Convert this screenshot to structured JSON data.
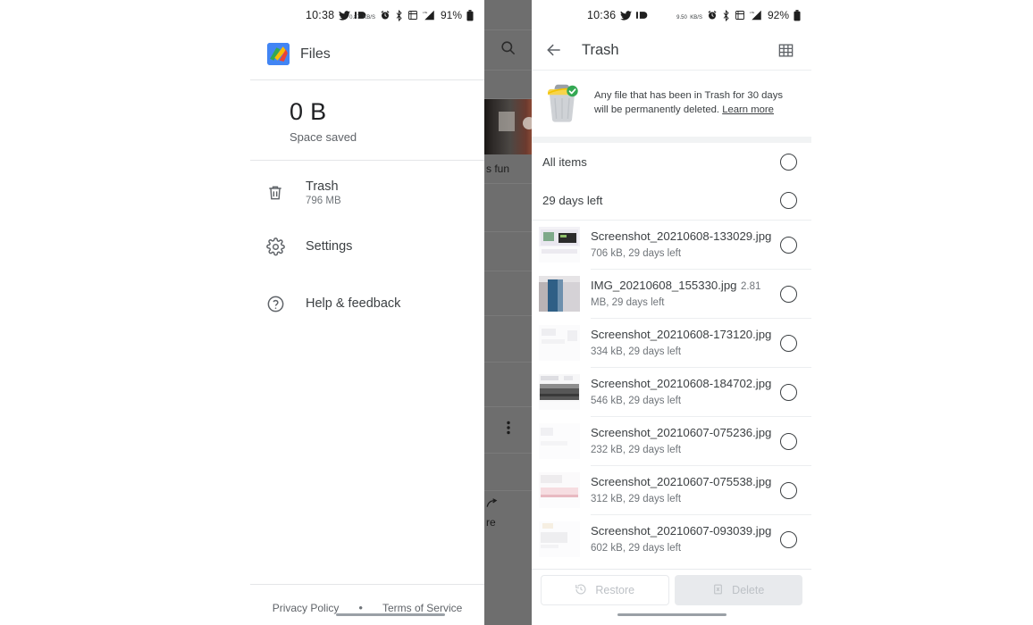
{
  "left_phone": {
    "status_bar": {
      "time": "10:38",
      "battery_percent": "91%",
      "data_rate": "0.87",
      "data_rate_unit": "KB/S",
      "icons": [
        "twitter-icon",
        "messaging-icon",
        "data-rate-icon",
        "alarm-icon",
        "bluetooth-icon",
        "screenshot-icon",
        "signal-icon",
        "battery-icon"
      ]
    },
    "drawer": {
      "app_name": "Files",
      "app_logo": "files-logo-icon",
      "space_saved_value": "0 B",
      "space_saved_label": "Space saved",
      "items": [
        {
          "label": "Trash",
          "sub": "796 MB",
          "icon": "trash-icon"
        },
        {
          "label": "Settings",
          "sub": "",
          "icon": "gear-icon"
        },
        {
          "label": "Help & feedback",
          "sub": "",
          "icon": "help-circle-icon"
        }
      ],
      "footer": {
        "privacy": "Privacy Policy",
        "separator": "•",
        "terms": "Terms of Service"
      }
    },
    "scrim": {
      "search_icon": "search-icon",
      "caption_fragment": "s fun",
      "overflow_icon": "more-vert-icon",
      "share_fragment": "re"
    }
  },
  "right_phone": {
    "status_bar": {
      "time": "10:36",
      "battery_percent": "92%",
      "data_rate": "9.50",
      "data_rate_unit": "KB/S",
      "icons": [
        "twitter-icon",
        "messaging-icon",
        "data-rate-icon",
        "alarm-icon",
        "bluetooth-icon",
        "screenshot-icon",
        "signal-icon",
        "battery-icon"
      ]
    },
    "appbar": {
      "back_icon": "back-arrow-icon",
      "title": "Trash",
      "grid_icon": "grid-view-icon"
    },
    "banner": {
      "art": "trash-can-illustration",
      "text": "Any file that has been in Trash for 30 days will be permanently deleted.",
      "link": "Learn more"
    },
    "sections": [
      {
        "label": "All items",
        "selected": false
      },
      {
        "label": "29 days left",
        "selected": false
      }
    ],
    "files": [
      {
        "name": "Screenshot_20210608-133029.jpg",
        "size": "706 kB",
        "expiry": "29 days left",
        "selected": false
      },
      {
        "name": "IMG_20210608_155330.jpg",
        "size": "2.81 MB",
        "expiry": "29 days left",
        "selected": false
      },
      {
        "name": "Screenshot_20210608-173120.jpg",
        "size": "334 kB",
        "expiry": "29 days left",
        "selected": false
      },
      {
        "name": "Screenshot_20210608-184702.jpg",
        "size": "546 kB",
        "expiry": "29 days left",
        "selected": false
      },
      {
        "name": "Screenshot_20210607-075236.jpg",
        "size": "232 kB",
        "expiry": "29 days left",
        "selected": false
      },
      {
        "name": "Screenshot_20210607-075538.jpg",
        "size": "312 kB",
        "expiry": "29 days left",
        "selected": false
      },
      {
        "name": "Screenshot_20210607-093039.jpg",
        "size": "602 kB",
        "expiry": "29 days left",
        "selected": false
      }
    ],
    "actions": {
      "restore_label": "Restore",
      "restore_icon": "restore-icon",
      "restore_enabled": false,
      "delete_label": "Delete",
      "delete_icon": "delete-forever-icon",
      "delete_enabled": false
    }
  },
  "colors": {
    "accent_blue": "#4285F4",
    "google_green": "#34A853",
    "google_yellow": "#FBBC04",
    "google_red": "#EA4335",
    "text_primary": "#3c4043",
    "text_secondary": "#70757a",
    "scrim": "#6e6e6e",
    "divider": "#e8eaed"
  }
}
